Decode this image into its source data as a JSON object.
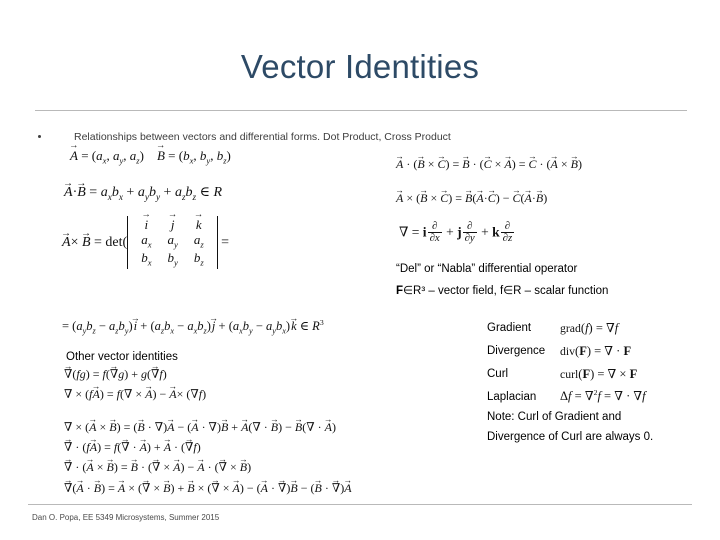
{
  "slide": {
    "title": "Vector Identities",
    "bullet": {
      "marker": "bullet-dot",
      "text": "Relationships between vectors and differential forms. Dot Product, Cross Product"
    },
    "footer": "Dan O. Popa, EE 5349 Microsystems, Summer 2015",
    "colors": {
      "title": "#2d4a66",
      "rule": "#b9b9b9",
      "body_text": "#3d3d3d",
      "math": "#111111",
      "background": "#ffffff"
    }
  },
  "math_left": {
    "definitions": "A = (a_x, a_y, a_z)   B = (b_x, b_y, b_z)",
    "dot_product": "A . B = a_x b_x + a_y b_y + a_z b_z in R",
    "cross_product": "A x B = det( | i j k ; a_x a_y a_z ; b_x b_y b_z | ) =",
    "cross_expansion": "= (a_y b_z - a_z b_y) i + (a_z b_x - a_x b_z) j + (a_x b_y - a_y b_x) k in R^3",
    "determinant": {
      "rows": [
        [
          "i",
          "j",
          "k"
        ],
        [
          "a_x",
          "a_y",
          "a_z"
        ],
        [
          "b_x",
          "b_y",
          "b_z"
        ]
      ]
    }
  },
  "math_right": {
    "triple_scalar": "A . (B x C) = B . (C x A) = C . (A x B)",
    "triple_vector": "A x (B x C) = B(A . C) - C(A . B)",
    "nabla": "grad = i d/dx + j d/dy + k d/dz"
  },
  "annotations": {
    "del_operator": "“Del” or “Nabla” differential operator",
    "fields_line_pre": "F",
    "fields_line": "∈R³ – vector field, f∈R – scalar function",
    "other_identities": "Other vector identities",
    "note_line1": "Note: Curl of Gradient and",
    "note_line2": "Divergence of Curl are always 0."
  },
  "operators": [
    {
      "label": "Gradient",
      "formula": "grad(f) = ∇f"
    },
    {
      "label": "Divergence",
      "formula": "div(F) = ∇ · F"
    },
    {
      "label": "Curl",
      "formula": "curl(F) = ∇ × F"
    },
    {
      "label": "Laplacian",
      "formula": "Δf = ∇²f = ∇ · ∇f"
    }
  ],
  "identities": [
    "∇(fg) = f(∇g) + g(∇f)",
    "∇ × (fA) = f(∇ × A) - A × (∇f)",
    "∇ × (A × B) = (B · ∇)A - (A · ∇)B + A(∇ · B) - B(∇ · A)",
    "∇ · (fA) = f(∇ · A) + A · (∇f)",
    "∇ · (A × B) = B · (∇ × A) - A · (∇ × B)",
    "∇(A · B) = A × (∇ × B) + B × (∇ × A) - (A · ∇)B - (B · ∇)A"
  ]
}
